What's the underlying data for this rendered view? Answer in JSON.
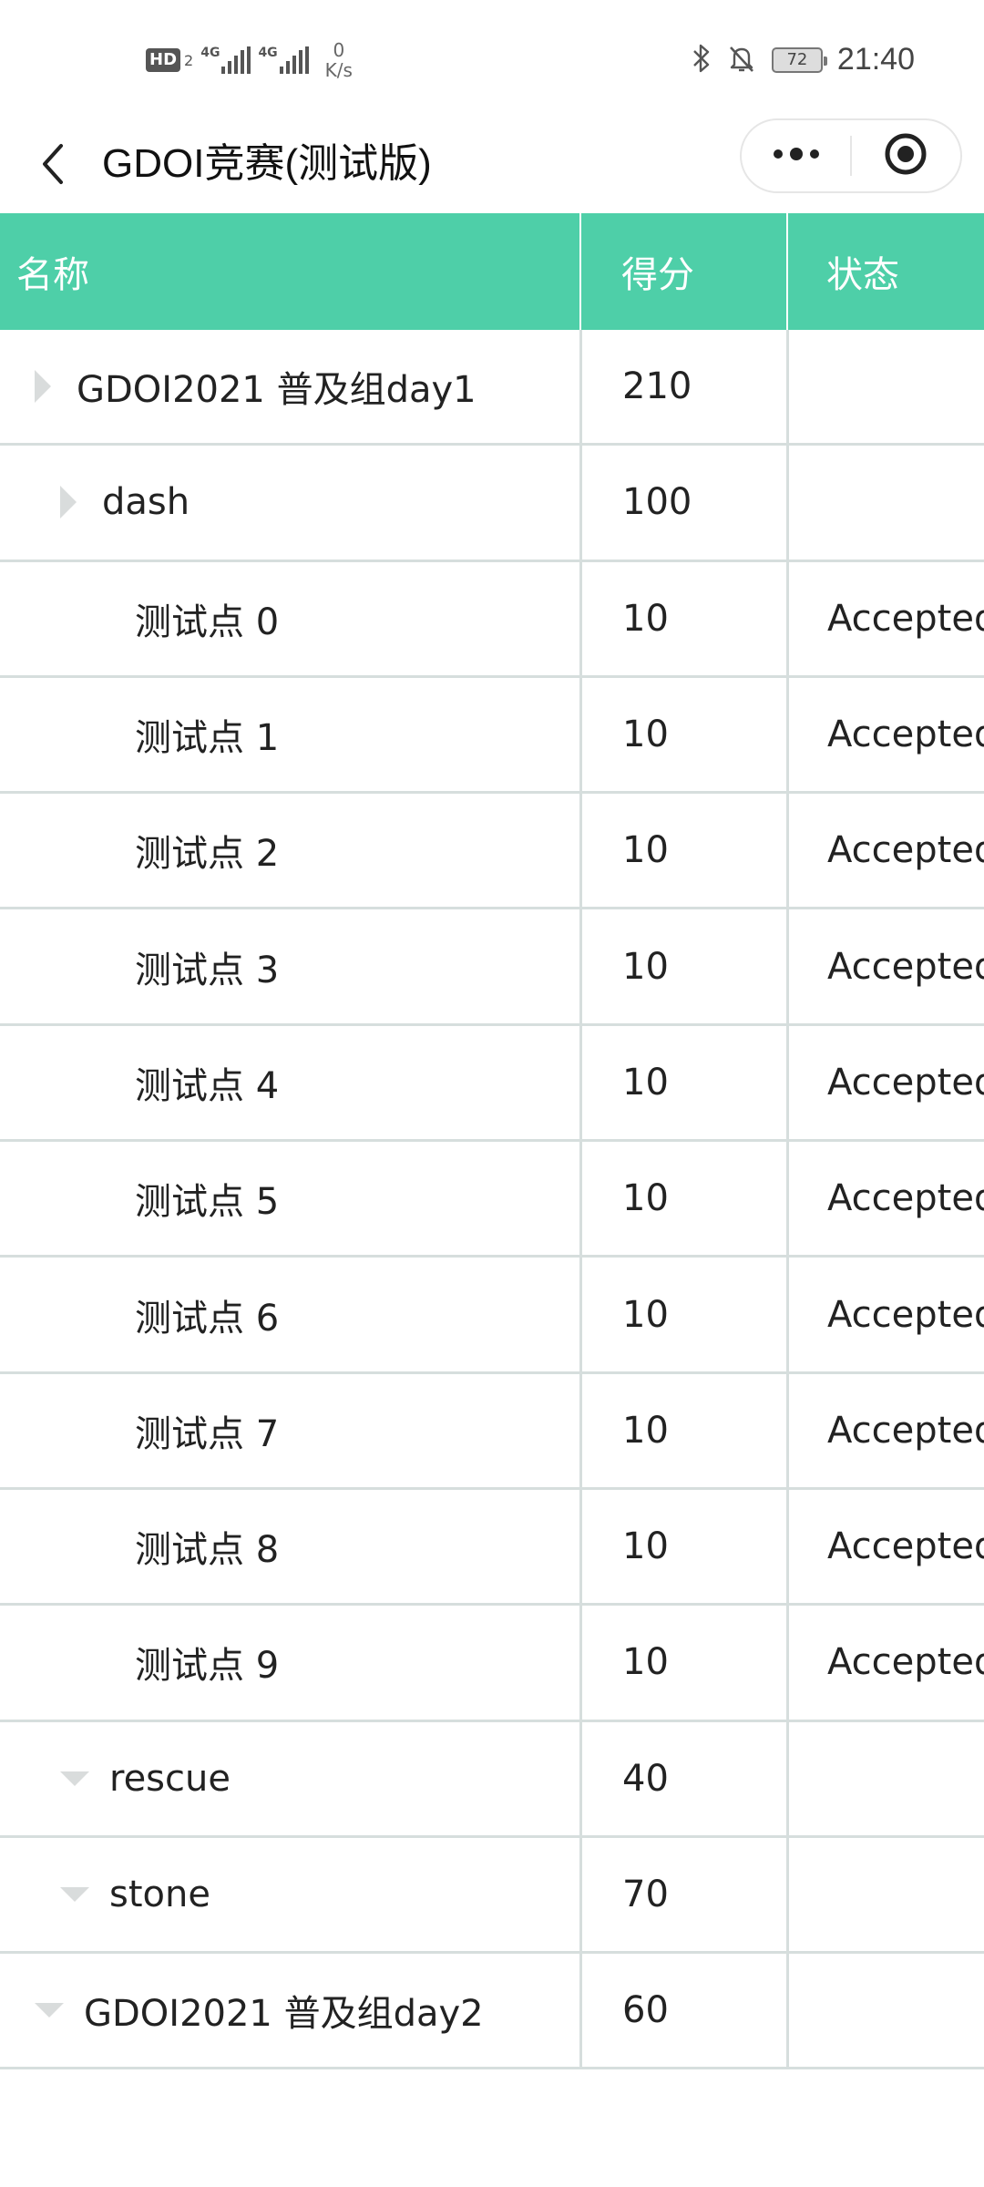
{
  "status_bar": {
    "hd": "HD",
    "hd_sub": "2",
    "net1": "4G",
    "net2": "4G",
    "speed_value": "0",
    "speed_unit": "K/s",
    "battery": "72",
    "time": "21:40"
  },
  "nav": {
    "title": "GDOI竞赛(测试版)"
  },
  "table": {
    "headers": {
      "name": "名称",
      "score": "得分",
      "status": "状态"
    },
    "rows": [
      {
        "name": "GDOI2021 普及组day1",
        "score": "210",
        "status": ""
      },
      {
        "name": "dash",
        "score": "100",
        "status": ""
      },
      {
        "name": "测试点 0",
        "score": "10",
        "status": "Accepted"
      },
      {
        "name": "测试点 1",
        "score": "10",
        "status": "Accepted"
      },
      {
        "name": "测试点 2",
        "score": "10",
        "status": "Accepted"
      },
      {
        "name": "测试点 3",
        "score": "10",
        "status": "Accepted"
      },
      {
        "name": "测试点 4",
        "score": "10",
        "status": "Accepted"
      },
      {
        "name": "测试点 5",
        "score": "10",
        "status": "Accepted"
      },
      {
        "name": "测试点 6",
        "score": "10",
        "status": "Accepted"
      },
      {
        "name": "测试点 7",
        "score": "10",
        "status": "Accepted"
      },
      {
        "name": "测试点 8",
        "score": "10",
        "status": "Accepted"
      },
      {
        "name": "测试点 9",
        "score": "10",
        "status": "Accepted"
      },
      {
        "name": "rescue",
        "score": "40",
        "status": ""
      },
      {
        "name": "stone",
        "score": "70",
        "status": ""
      },
      {
        "name": "GDOI2021 普及组day2",
        "score": "60",
        "status": ""
      }
    ]
  },
  "colors": {
    "header_bg": "#4ecfa8",
    "header_text": "#ffffff",
    "grid_line": "#d6dedd",
    "expander": "#d9dcdc"
  }
}
